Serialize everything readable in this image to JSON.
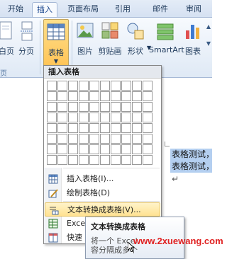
{
  "tabs": [
    {
      "label": "开始",
      "active": false
    },
    {
      "label": "插入",
      "active": true
    },
    {
      "label": "页面布局",
      "active": false
    },
    {
      "label": "引用",
      "active": false
    },
    {
      "label": "邮件",
      "active": false
    },
    {
      "label": "审阅",
      "active": false
    }
  ],
  "ribbon": {
    "blank_page": "白页",
    "page_break": "分页",
    "table": "表格",
    "picture": "图片",
    "clip_art": "剪贴画",
    "shapes": "形状",
    "smartart": "SmartArt",
    "chart": "图表",
    "group_pages_fragment": "页"
  },
  "dropdown": {
    "header": "插入表格",
    "grid_rows": 8,
    "grid_cols": 10,
    "items": [
      {
        "label": "插入表格(I)...",
        "icon": "insert-table-icon"
      },
      {
        "label": "绘制表格(D)",
        "icon": "draw-table-icon"
      },
      {
        "label": "文本转换成表格(V)...",
        "icon": "convert-text-icon"
      },
      {
        "label": "Excel",
        "icon": "excel-icon"
      },
      {
        "label": "快速",
        "icon": "quick-table-icon"
      }
    ]
  },
  "document": {
    "line1": "表格测试，",
    "line2": "表格测试，",
    "paragraph_mark": "↵"
  },
  "tooltip": {
    "title": "文本转换成表格",
    "body_line1": "将一个 Excel",
    "body_line2": "容分隔成多个"
  },
  "watermark": "www.2xuewang.com",
  "colors": {
    "ribbon_bg": "#dfe9f5",
    "accent_pressed": "#ffc457",
    "hover_item": "#ffe291",
    "selection": "#b4cff0",
    "watermark": "#e02020"
  }
}
